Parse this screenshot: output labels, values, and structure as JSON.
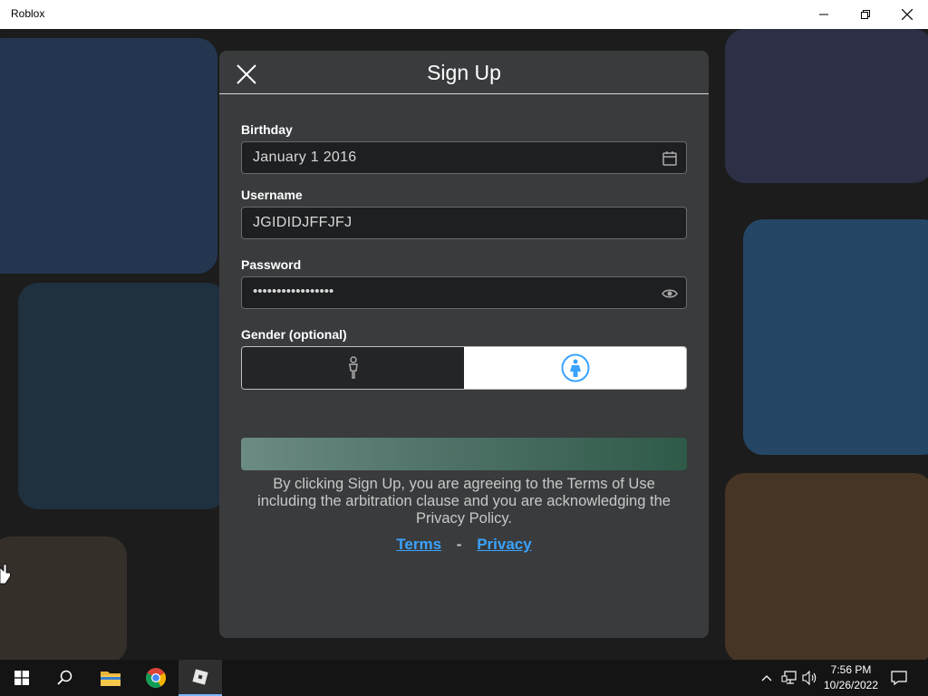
{
  "window": {
    "title": "Roblox"
  },
  "dialog": {
    "title": "Sign Up",
    "birthday": {
      "label": "Birthday",
      "value": "January 1 2016"
    },
    "username": {
      "label": "Username",
      "value": "JGIDIDJFFJFJ"
    },
    "password": {
      "label": "Password",
      "value": "•••••••••••••••••"
    },
    "gender": {
      "label": "Gender (optional)",
      "options": [
        "male",
        "female"
      ],
      "selected": "female"
    },
    "legal_text": "By clicking Sign Up, you are agreeing to the Terms of Use including the arbitration clause and you are acknowledging the Privacy Policy.",
    "links": {
      "terms": "Terms",
      "separator": "-",
      "privacy": "Privacy"
    }
  },
  "taskbar": {
    "clock": {
      "time": "7:56 PM",
      "date": "10/26/2022"
    }
  },
  "colors": {
    "accent_link": "#3aa3ff",
    "modal_bg": "#393b3d",
    "field_bg": "#1e1f21"
  }
}
